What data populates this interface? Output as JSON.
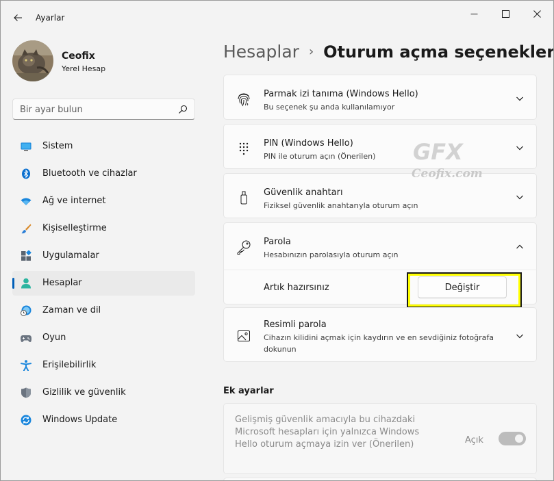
{
  "window": {
    "title": "Ayarlar"
  },
  "profile": {
    "name": "Ceofix",
    "account_type": "Yerel Hesap"
  },
  "search": {
    "placeholder": "Bir ayar bulun"
  },
  "nav": {
    "items": [
      {
        "label": "Sistem",
        "icon": "monitor-icon"
      },
      {
        "label": "Bluetooth ve cihazlar",
        "icon": "bluetooth-icon"
      },
      {
        "label": "Ağ ve internet",
        "icon": "wifi-icon"
      },
      {
        "label": "Kişiselleştirme",
        "icon": "brush-icon"
      },
      {
        "label": "Uygulamalar",
        "icon": "apps-icon"
      },
      {
        "label": "Hesaplar",
        "icon": "person-icon",
        "active": true
      },
      {
        "label": "Zaman ve dil",
        "icon": "clock-globe-icon"
      },
      {
        "label": "Oyun",
        "icon": "gamepad-icon"
      },
      {
        "label": "Erişilebilirlik",
        "icon": "accessibility-icon"
      },
      {
        "label": "Gizlilik ve güvenlik",
        "icon": "shield-icon"
      },
      {
        "label": "Windows Update",
        "icon": "update-icon"
      }
    ]
  },
  "breadcrumb": {
    "parent": "Hesaplar",
    "separator": "›",
    "current": "Oturum açma seçenekleri"
  },
  "signin_options": [
    {
      "title": "Parmak izi tanıma (Windows Hello)",
      "subtitle": "Bu seçenek şu anda kullanılamıyor",
      "icon": "fingerprint-icon",
      "expanded": false
    },
    {
      "title": "PIN (Windows Hello)",
      "subtitle": "PIN ile oturum açın (Önerilen)",
      "icon": "pin-keypad-icon",
      "expanded": false
    },
    {
      "title": "Güvenlik anahtarı",
      "subtitle": "Fiziksel güvenlik anahtarıyla oturum açın",
      "icon": "usb-key-icon",
      "expanded": false
    },
    {
      "title": "Parola",
      "subtitle": "Hesabınızın parolasıyla oturum açın",
      "icon": "key-icon",
      "expanded": true
    },
    {
      "title": "Resimli parola",
      "subtitle": "Cihazın kilidini açmak için kaydırın ve en sevdiğiniz fotoğrafa dokunun",
      "icon": "picture-icon",
      "expanded": false
    }
  ],
  "password_panel": {
    "status_label": "Artık hazırsınız",
    "change_button": "Değiştir"
  },
  "extra_settings": {
    "title": "Ek ayarlar",
    "hello_only": {
      "text": "Gelişmiş güvenlik amacıyla bu cihazdaki Microsoft hesapları için yalnızca Windows Hello oturum açmaya izin ver (Önerilen)",
      "toggle_label": "Açık",
      "enabled": false
    }
  },
  "watermark": {
    "logo": "GFX",
    "text": "Ceofix.com"
  },
  "colors": {
    "accent": "#005fb8",
    "highlight": "#ffff00"
  }
}
